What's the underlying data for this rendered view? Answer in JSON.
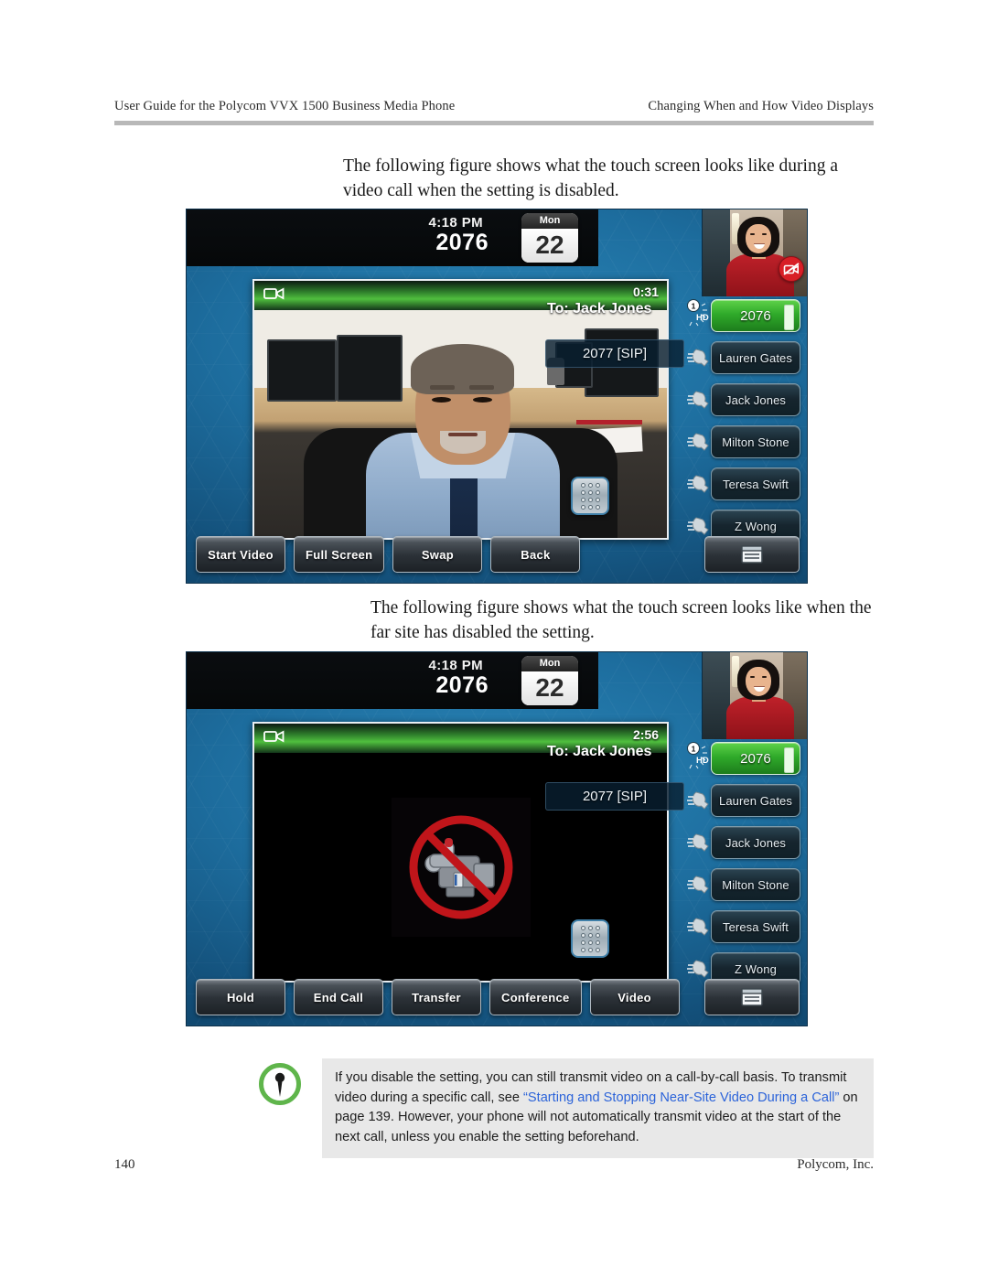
{
  "header": {
    "left": "User Guide for the Polycom VVX 1500 Business Media Phone",
    "right": "Changing When and How Video Displays"
  },
  "body": {
    "paragraph_1": "The following figure shows what the touch screen looks like during a video call when the setting is disabled.",
    "paragraph_2": "The following figure shows what the touch screen looks like when the far site has disabled the setting."
  },
  "figure_1": {
    "status_bar": {
      "time": "4:18 PM",
      "extension": "2076",
      "calendar_weekday": "Mon",
      "calendar_day": "22"
    },
    "call_window": {
      "timer": "0:31",
      "camera_icon": "video-camera-icon"
    },
    "call_info": {
      "to_label": "To:",
      "to_name": "Jack Jones",
      "number": "2077 [SIP]"
    },
    "selfview": {
      "badge_icon": "camera-muted-icon"
    },
    "dialpad_icon": "dialpad-icon",
    "line_keys": [
      {
        "label": "2076",
        "active": true,
        "icon": "hd-line-icon",
        "index": "1"
      },
      {
        "label": "Lauren Gates",
        "active": false,
        "icon": "handset-icon"
      },
      {
        "label": "Jack Jones",
        "active": false,
        "icon": "handset-icon"
      },
      {
        "label": "Milton Stone",
        "active": false,
        "icon": "handset-icon"
      },
      {
        "label": "Teresa Swift",
        "active": false,
        "icon": "handset-icon"
      },
      {
        "label": "Z Wong",
        "active": false,
        "icon": "handset-icon"
      }
    ],
    "soft_keys": [
      "Start Video",
      "Full Screen",
      "Swap",
      "Back"
    ],
    "menu_key_icon": "menu-window-icon"
  },
  "figure_2": {
    "status_bar": {
      "time": "4:18 PM",
      "extension": "2076",
      "calendar_weekday": "Mon",
      "calendar_day": "22"
    },
    "call_window": {
      "timer": "2:56",
      "camera_icon": "video-camera-icon",
      "video_placeholder_icon": "camera-disabled-icon"
    },
    "call_info": {
      "to_label": "To:",
      "to_name": "Jack Jones",
      "number": "2077 [SIP]"
    },
    "dialpad_icon": "dialpad-icon",
    "line_keys": [
      {
        "label": "2076",
        "active": true,
        "icon": "hd-line-icon",
        "index": "1"
      },
      {
        "label": "Lauren Gates",
        "active": false,
        "icon": "handset-icon"
      },
      {
        "label": "Jack Jones",
        "active": false,
        "icon": "handset-icon"
      },
      {
        "label": "Milton Stone",
        "active": false,
        "icon": "handset-icon"
      },
      {
        "label": "Teresa Swift",
        "active": false,
        "icon": "handset-icon"
      },
      {
        "label": "Z Wong",
        "active": false,
        "icon": "handset-icon"
      }
    ],
    "soft_keys": [
      "Hold",
      "End Call",
      "Transfer",
      "Conference",
      "Video"
    ],
    "menu_key_icon": "menu-window-icon"
  },
  "note": {
    "icon": "pushpin-note-icon",
    "text_part_1": "If you disable the setting, you can still transmit video on a call-by-call basis. To transmit video during a specific call, see ",
    "link_text": "“Starting and Stopping Near-Site Video During a Call”",
    "text_part_2": " on page 139. However, your phone will not automatically transmit video at the start of the next call, unless you enable the setting beforehand.",
    "link_color": "#2b63d9"
  },
  "footer": {
    "page_number": "140",
    "company": "Polycom, Inc."
  }
}
